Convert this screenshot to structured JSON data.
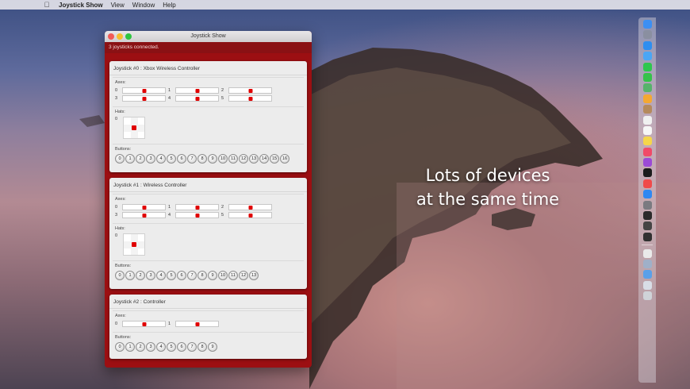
{
  "menubar": {
    "app_name": "Joystick Show",
    "items": [
      "View",
      "Window",
      "Help"
    ]
  },
  "window": {
    "title": "Joystick Show",
    "status": "3 joysticks connected.",
    "labels": {
      "axes": "Axes:",
      "hats": "Hats:",
      "buttons": "Buttons:"
    }
  },
  "joysticks": [
    {
      "title": "Joystick #0 : Xbox Wireless Controller",
      "axes": [
        {
          "index": "0",
          "value": 0.5
        },
        {
          "index": "1",
          "value": 0.5
        },
        {
          "index": "2",
          "value": 0.5
        },
        {
          "index": "3",
          "value": 0.5
        },
        {
          "index": "4",
          "value": 0.5
        },
        {
          "index": "5",
          "value": 0.5
        }
      ],
      "hats": [
        {
          "index": "0",
          "direction": "centered"
        }
      ],
      "buttons": [
        "0",
        "1",
        "2",
        "3",
        "4",
        "5",
        "6",
        "7",
        "8",
        "9",
        "10",
        "11",
        "12",
        "13",
        "14",
        "15",
        "16"
      ]
    },
    {
      "title": "Joystick #1 : Wireless Controller",
      "axes": [
        {
          "index": "0",
          "value": 0.5
        },
        {
          "index": "1",
          "value": 0.5
        },
        {
          "index": "2",
          "value": 0.5
        },
        {
          "index": "3",
          "value": 0.5
        },
        {
          "index": "4",
          "value": 0.5
        },
        {
          "index": "5",
          "value": 0.5
        }
      ],
      "hats": [
        {
          "index": "0",
          "direction": "centered"
        }
      ],
      "buttons": [
        "0",
        "1",
        "2",
        "3",
        "4",
        "5",
        "6",
        "7",
        "8",
        "9",
        "10",
        "11",
        "12",
        "13"
      ]
    },
    {
      "title": "Joystick #2 : Controller",
      "axes": [
        {
          "index": "0",
          "value": 0.5
        },
        {
          "index": "1",
          "value": 0.5
        }
      ],
      "hats": [],
      "buttons": [
        "0",
        "1",
        "2",
        "3",
        "4",
        "5",
        "6",
        "7",
        "8",
        "9"
      ]
    }
  ],
  "caption": {
    "line1": "Lots of devices",
    "line2": "at the same time"
  },
  "dock": {
    "icons": [
      {
        "name": "finder-icon",
        "color": "#3c8ff2"
      },
      {
        "name": "launchpad-icon",
        "color": "#8a8fa0"
      },
      {
        "name": "safari-icon",
        "color": "#2e8ef0"
      },
      {
        "name": "mail-icon",
        "color": "#4aa6f5"
      },
      {
        "name": "messages-icon",
        "color": "#2ec74d"
      },
      {
        "name": "facetime-icon",
        "color": "#35c24a"
      },
      {
        "name": "maps-icon",
        "color": "#56b36b"
      },
      {
        "name": "photos-icon",
        "color": "#f4a832"
      },
      {
        "name": "contacts-icon",
        "color": "#b58a5c"
      },
      {
        "name": "calendar-icon",
        "color": "#f0f0f0"
      },
      {
        "name": "reminders-icon",
        "color": "#f6f6f6"
      },
      {
        "name": "notes-icon",
        "color": "#f5d64a"
      },
      {
        "name": "music-icon",
        "color": "#f04a68"
      },
      {
        "name": "podcasts-icon",
        "color": "#9b4ad6"
      },
      {
        "name": "tv-icon",
        "color": "#1b1b1b"
      },
      {
        "name": "news-icon",
        "color": "#f04a4a"
      },
      {
        "name": "app-store-icon",
        "color": "#2f88f2"
      },
      {
        "name": "system-preferences-icon",
        "color": "#7a7a80"
      },
      {
        "name": "terminal-icon",
        "color": "#2a2a2a"
      },
      {
        "name": "console-icon",
        "color": "#444444"
      },
      {
        "name": "joystick-show-icon",
        "color": "#303030"
      },
      {
        "name": "preview-icon",
        "color": "#eaeaea"
      },
      {
        "name": "downloads-icon",
        "color": "#9fb0c8"
      },
      {
        "name": "folder-icon",
        "color": "#5aa0e8"
      },
      {
        "name": "documents-icon",
        "color": "#d8dde6"
      },
      {
        "name": "trash-icon",
        "color": "#cfd3d8"
      }
    ]
  }
}
